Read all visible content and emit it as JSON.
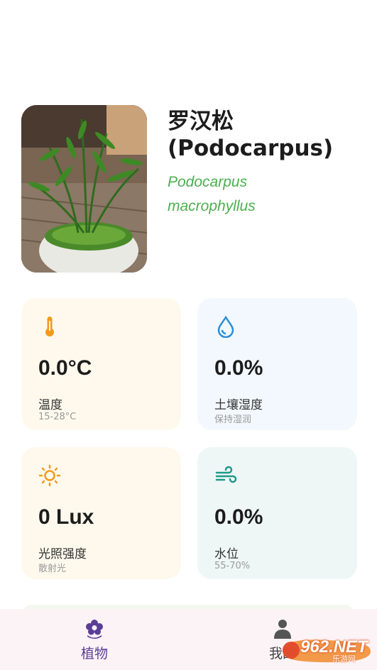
{
  "plant": {
    "name_cn": "罗汉松",
    "name_en": "(Podocarpus)",
    "latin_1": "Podocarpus",
    "latin_2": "macrophyllus"
  },
  "metrics": {
    "temperature": {
      "value": "0.0°C",
      "label": "温度",
      "range": "15-28°C",
      "icon": "thermometer-icon",
      "color": "#f29a1f"
    },
    "soil": {
      "value": "0.0%",
      "label": "土壤湿度",
      "range": "保持湿润",
      "icon": "water-drop-icon",
      "color": "#2b8fd8"
    },
    "light": {
      "value": "0 Lux",
      "label": "光照强度",
      "range": "散射光",
      "icon": "sun-icon",
      "color": "#f29a1f"
    },
    "water": {
      "value": "0.0%",
      "label": "水位",
      "range": "55-70%",
      "icon": "wind-icon",
      "color": "#1e9a8a"
    }
  },
  "nav": {
    "plants": {
      "label": "植物",
      "icon": "flower-icon"
    },
    "me": {
      "label": "我的",
      "icon": "person-icon"
    }
  },
  "watermark": {
    "text": "962.NET",
    "sub": "乐游网"
  },
  "colors": {
    "accent": "#5b3e96",
    "latin": "#4caf50",
    "nav_bg": "#fcf3f7"
  }
}
